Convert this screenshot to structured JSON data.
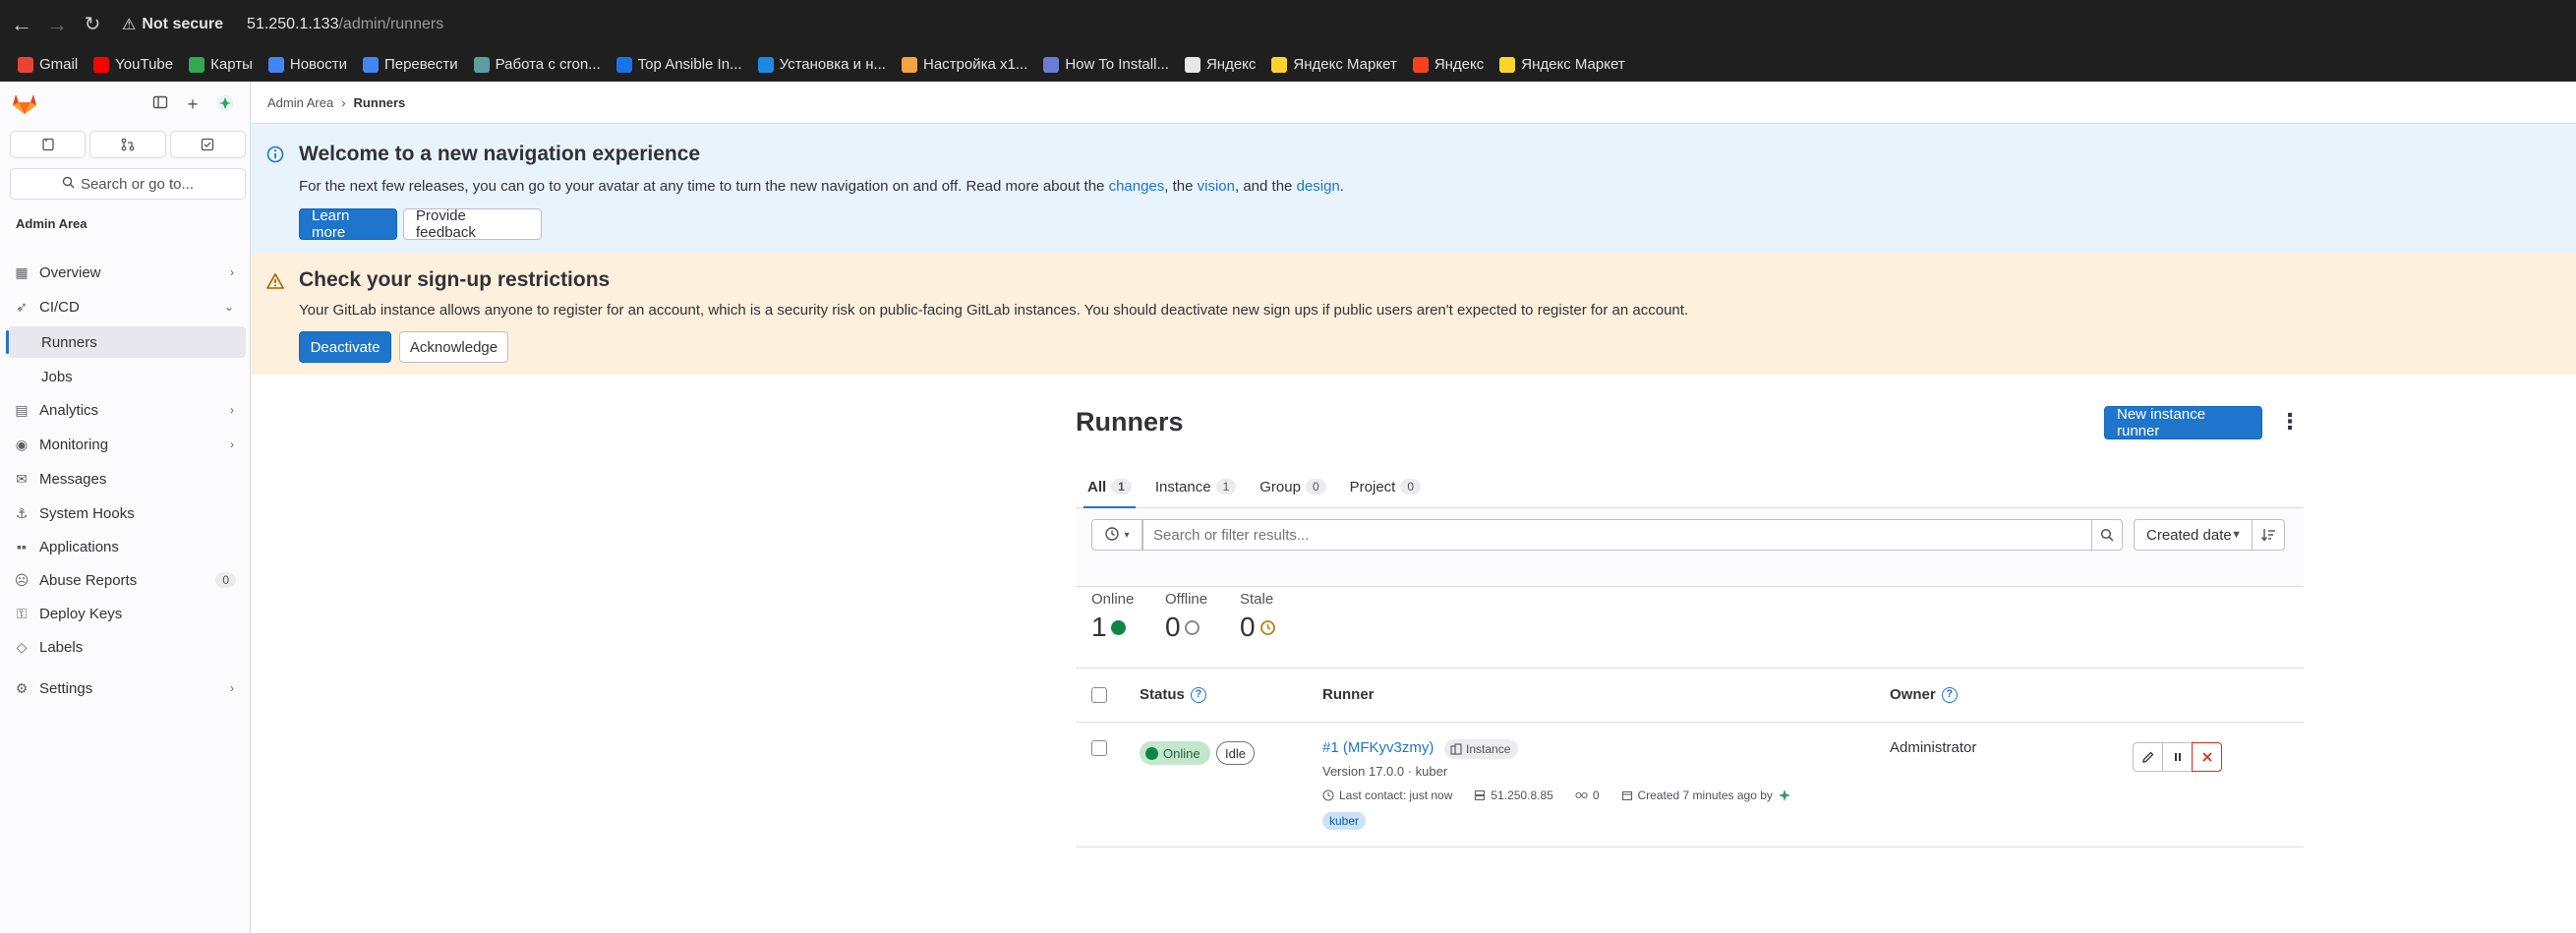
{
  "browser": {
    "security_label": "Not secure",
    "url_host": "51.250.1.133",
    "url_path": "/admin/runners",
    "bookmarks": [
      {
        "label": "Gmail",
        "color": "#ea4335"
      },
      {
        "label": "YouTube",
        "color": "#ff0000"
      },
      {
        "label": "Карты",
        "color": "#34a853"
      },
      {
        "label": "Новости",
        "color": "#4285f4"
      },
      {
        "label": "Перевести",
        "color": "#4285f4"
      },
      {
        "label": "Работа с cron...",
        "color": "#5f9ea0"
      },
      {
        "label": "Top Ansible In...",
        "color": "#1a73e8"
      },
      {
        "label": "Установка и н...",
        "color": "#1e88e5"
      },
      {
        "label": "Настройка x1...",
        "color": "#f4a340"
      },
      {
        "label": "How To Install...",
        "color": "#6b7cd6"
      },
      {
        "label": "Яндекс",
        "color": "#e8e8e8"
      },
      {
        "label": "Яндекс Маркет",
        "color": "#fed42b"
      },
      {
        "label": "Яндекс",
        "color": "#fc3f1d"
      },
      {
        "label": "Яндекс Маркет",
        "color": "#fed42b"
      }
    ]
  },
  "sidebar": {
    "search_label": "Search or go to...",
    "section_title": "Admin Area",
    "items": [
      {
        "label": "Overview",
        "icon": "overview-icon"
      },
      {
        "label": "CI/CD",
        "icon": "rocket-icon"
      },
      {
        "label": "Runners"
      },
      {
        "label": "Jobs"
      },
      {
        "label": "Analytics",
        "icon": "chart-icon"
      },
      {
        "label": "Monitoring",
        "icon": "monitor-icon"
      },
      {
        "label": "Messages",
        "icon": "messages-icon"
      },
      {
        "label": "System Hooks",
        "icon": "hook-icon"
      },
      {
        "label": "Applications",
        "icon": "applications-icon"
      },
      {
        "label": "Abuse Reports",
        "icon": "abuse-icon",
        "count": "0"
      },
      {
        "label": "Deploy Keys",
        "icon": "key-icon"
      },
      {
        "label": "Labels",
        "icon": "label-icon"
      },
      {
        "label": "Settings",
        "icon": "settings-icon"
      }
    ]
  },
  "breadcrumb": {
    "parent": "Admin Area",
    "separator": "›",
    "current": "Runners"
  },
  "info_alert": {
    "title": "Welcome to a new navigation experience",
    "text_prefix": "For the next few releases, you can go to your avatar at any time to turn the new navigation on and off. Read more about the ",
    "link_changes": "changes",
    "text_mid1": ", the ",
    "link_vision": "vision",
    "text_mid2": ", and the ",
    "link_design": "design",
    "text_end": ".",
    "primary_button": "Learn more",
    "secondary_button": "Provide feedback"
  },
  "warning_alert": {
    "title": "Check your sign-up restrictions",
    "text": "Your GitLab instance allows anyone to register for an account, which is a security risk on public-facing GitLab instances. You should deactivate new sign ups if public users aren't expected to register for an account.",
    "primary_button": "Deactivate",
    "secondary_button": "Acknowledge"
  },
  "page": {
    "title": "Runners",
    "new_button": "New instance runner",
    "tabs": [
      {
        "label": "All",
        "count": "1"
      },
      {
        "label": "Instance",
        "count": "1"
      },
      {
        "label": "Group",
        "count": "0"
      },
      {
        "label": "Project",
        "count": "0"
      }
    ],
    "search_placeholder": "Search or filter results...",
    "sort_label": "Created date",
    "stats": [
      {
        "label": "Online",
        "value": "1"
      },
      {
        "label": "Offline",
        "value": "0"
      },
      {
        "label": "Stale",
        "value": "0"
      }
    ],
    "table": {
      "col_status": "Status",
      "col_runner": "Runner",
      "col_owner": "Owner"
    },
    "runner": {
      "status": "Online",
      "state": "Idle",
      "name": "#1 (MFKyv3zmy)",
      "type": "Instance",
      "version": "Version 17.0.0 · kuber",
      "last_contact": "Last contact: just now",
      "ip": "51.250.8.85",
      "jobs": "0",
      "created": "Created 7 minutes ago by",
      "tag": "kuber",
      "owner": "Administrator"
    }
  }
}
